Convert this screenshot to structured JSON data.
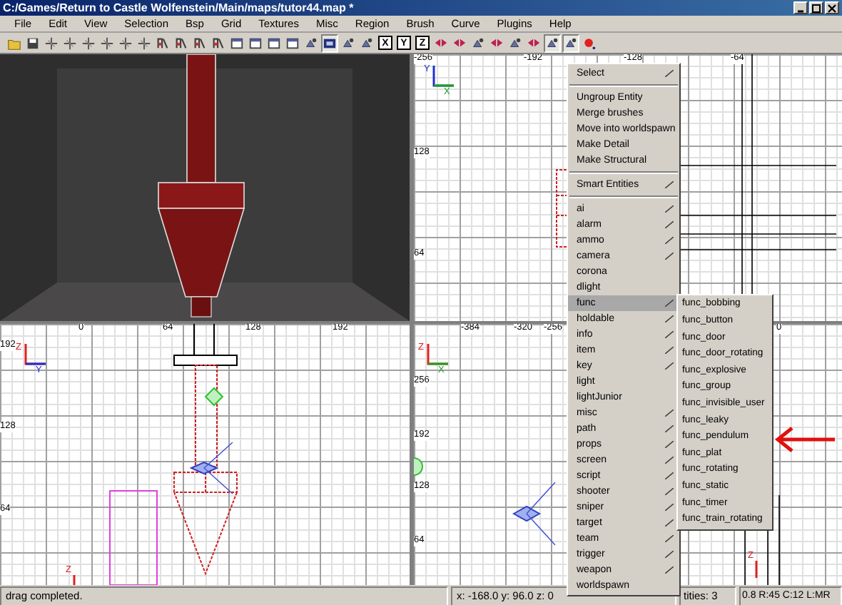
{
  "window": {
    "title": "C:/Games/Return to Castle Wolfenstein/Main/maps/tutor44.map *"
  },
  "menubar": [
    "File",
    "Edit",
    "View",
    "Selection",
    "Bsp",
    "Grid",
    "Textures",
    "Misc",
    "Region",
    "Brush",
    "Curve",
    "Plugins",
    "Help"
  ],
  "toolbar": [
    {
      "kind": "open"
    },
    {
      "kind": "save"
    },
    {
      "kind": "transform"
    },
    {
      "kind": "transform"
    },
    {
      "kind": "transform"
    },
    {
      "kind": "transform"
    },
    {
      "kind": "transform"
    },
    {
      "kind": "transform"
    },
    {
      "kind": "brush"
    },
    {
      "kind": "brush"
    },
    {
      "kind": "brush"
    },
    {
      "kind": "brush"
    },
    {
      "kind": "view"
    },
    {
      "kind": "view"
    },
    {
      "kind": "view"
    },
    {
      "kind": "view"
    },
    {
      "kind": "tool"
    },
    {
      "kind": "camera",
      "pressed": true
    },
    {
      "kind": "tool"
    },
    {
      "kind": "tool"
    },
    {
      "kind": "axis",
      "label": "X"
    },
    {
      "kind": "axis",
      "label": "Y"
    },
    {
      "kind": "axis",
      "label": "Z"
    },
    {
      "kind": "entity"
    },
    {
      "kind": "entity"
    },
    {
      "kind": "tool"
    },
    {
      "kind": "entity"
    },
    {
      "kind": "tool"
    },
    {
      "kind": "entity"
    },
    {
      "kind": "tool",
      "pressed": true
    },
    {
      "kind": "tool",
      "pressed": true
    },
    {
      "kind": "record"
    }
  ],
  "views": [
    {
      "kind": "camera"
    },
    {
      "kind": "grid",
      "top_labels": [
        "-256",
        "-192",
        "-128",
        "-64"
      ],
      "side_labels": [
        "128",
        "64"
      ],
      "axis": [
        "Y",
        "X"
      ]
    },
    {
      "kind": "grid",
      "top_labels": [
        "0",
        "64",
        "128",
        "192"
      ],
      "side_labels": [
        "192",
        "128",
        "64"
      ],
      "axis": [
        "Z",
        "Y"
      ],
      "z_marker": "Z"
    },
    {
      "kind": "grid",
      "top_labels": [
        "-384",
        "-320",
        "-256",
        "0"
      ],
      "side_labels": [
        "256",
        "192",
        "128",
        "64"
      ],
      "axis": [
        "Z",
        "X"
      ],
      "z_marker": "Z"
    }
  ],
  "status_bar": [
    "drag completed.",
    "x: -168.0  y: 96.0  z: 0",
    "tities: 3",
    "0.8 R:45 C:12 L:MR"
  ],
  "context_menu": {
    "groups": [
      [
        {
          "label": "Select",
          "submenu": true,
          "selected": false
        }
      ],
      [
        {
          "label": "Ungroup Entity",
          "submenu": false,
          "selected": false
        },
        {
          "label": "Merge brushes",
          "submenu": false,
          "selected": false
        },
        {
          "label": "Move into worldspawn",
          "submenu": false,
          "selected": false
        },
        {
          "label": "Make Detail",
          "submenu": false,
          "selected": false
        },
        {
          "label": "Make Structural",
          "submenu": false,
          "selected": false
        }
      ],
      [
        {
          "label": "Smart Entities",
          "submenu": true,
          "selected": false
        }
      ],
      [
        {
          "label": "ai",
          "submenu": true,
          "selected": false
        },
        {
          "label": "alarm",
          "submenu": true,
          "selected": false
        },
        {
          "label": "ammo",
          "submenu": true,
          "selected": false
        },
        {
          "label": "camera",
          "submenu": true,
          "selected": false
        },
        {
          "label": "corona",
          "submenu": false,
          "selected": false
        },
        {
          "label": "dlight",
          "submenu": false,
          "selected": false
        },
        {
          "label": "func",
          "submenu": true,
          "selected": true
        },
        {
          "label": "holdable",
          "submenu": true,
          "selected": false
        },
        {
          "label": "info",
          "submenu": true,
          "selected": false
        },
        {
          "label": "item",
          "submenu": true,
          "selected": false
        },
        {
          "label": "key",
          "submenu": true,
          "selected": false
        },
        {
          "label": "light",
          "submenu": false,
          "selected": false
        },
        {
          "label": "lightJunior",
          "submenu": false,
          "selected": false
        },
        {
          "label": "misc",
          "submenu": true,
          "selected": false
        },
        {
          "label": "path",
          "submenu": true,
          "selected": false
        },
        {
          "label": "props",
          "submenu": true,
          "selected": false
        },
        {
          "label": "screen",
          "submenu": true,
          "selected": false
        },
        {
          "label": "script",
          "submenu": true,
          "selected": false
        },
        {
          "label": "shooter",
          "submenu": true,
          "selected": false
        },
        {
          "label": "sniper",
          "submenu": true,
          "selected": false
        },
        {
          "label": "target",
          "submenu": true,
          "selected": false
        },
        {
          "label": "team",
          "submenu": true,
          "selected": false
        },
        {
          "label": "trigger",
          "submenu": true,
          "selected": false
        },
        {
          "label": "weapon",
          "submenu": true,
          "selected": false
        },
        {
          "label": "worldspawn",
          "submenu": false,
          "selected": false
        }
      ]
    ]
  },
  "submenu": [
    "func_bobbing",
    "func_button",
    "func_door",
    "func_door_rotating",
    "func_explosive",
    "func_group",
    "func_invisible_user",
    "func_leaky",
    "func_pendulum",
    "func_plat",
    "func_rotating",
    "func_static",
    "func_timer",
    "func_train_rotating"
  ]
}
